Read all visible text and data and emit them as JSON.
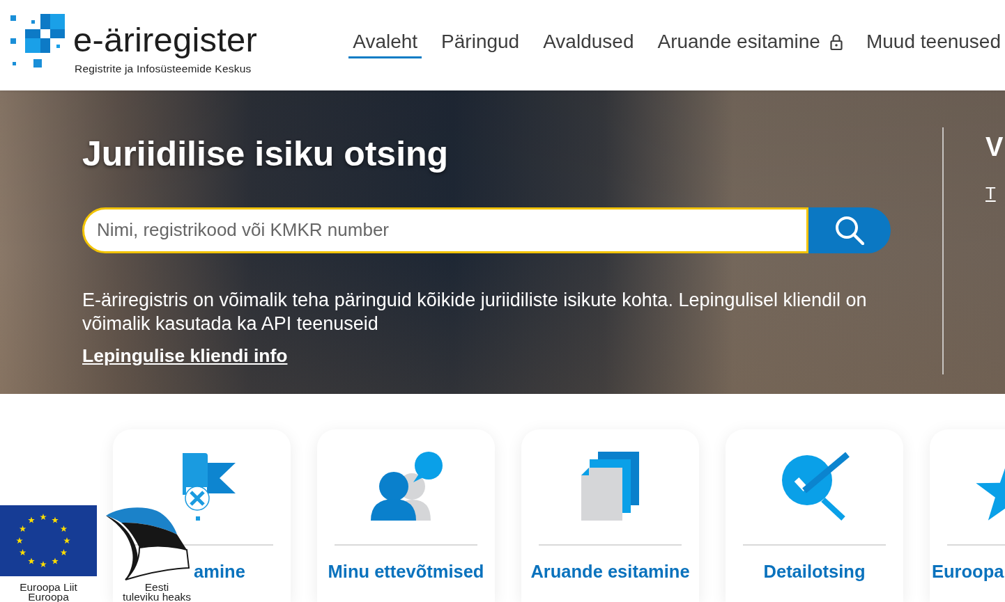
{
  "logo": {
    "title": "e-äriregister",
    "subtitle": "Registrite ja Infosüsteemide Keskus"
  },
  "nav": [
    {
      "label": "Avaleht",
      "selected": true,
      "locked": false
    },
    {
      "label": "Päringud",
      "selected": false,
      "locked": false
    },
    {
      "label": "Avaldused",
      "selected": false,
      "locked": false
    },
    {
      "label": "Aruande esitamine",
      "selected": false,
      "locked": true
    },
    {
      "label": "Muud teenused",
      "selected": false,
      "locked": false
    }
  ],
  "hero": {
    "title": "Juriidilise isiku otsing",
    "search": {
      "placeholder": "Nimi, registrikood või KMKR number"
    },
    "description": "E-äriregistris on võimalik teha päringuid kõikide juriidiliste isikute kohta. Lepingulisel kliendil on võimalik kasutada ka API teenuseid",
    "link": "Lepingulise kliendi info",
    "side_panel": {
      "heading": "V",
      "link": "T"
    }
  },
  "cards": [
    {
      "kind": "flag",
      "title": "amine"
    },
    {
      "kind": "people",
      "title": "Minu ettevõtmised"
    },
    {
      "kind": "documents",
      "title": "Aruande esitamine"
    },
    {
      "kind": "check-search",
      "title": "Detailotsing"
    },
    {
      "kind": "star",
      "title": "Euroopa"
    }
  ],
  "sponsor_logos": [
    {
      "kind": "eu-flag",
      "caption": [
        "Euroopa Liit",
        "Euroopa"
      ]
    },
    {
      "kind": "sail",
      "caption": [
        "Eesti",
        "tuleviku heaks"
      ]
    }
  ]
}
